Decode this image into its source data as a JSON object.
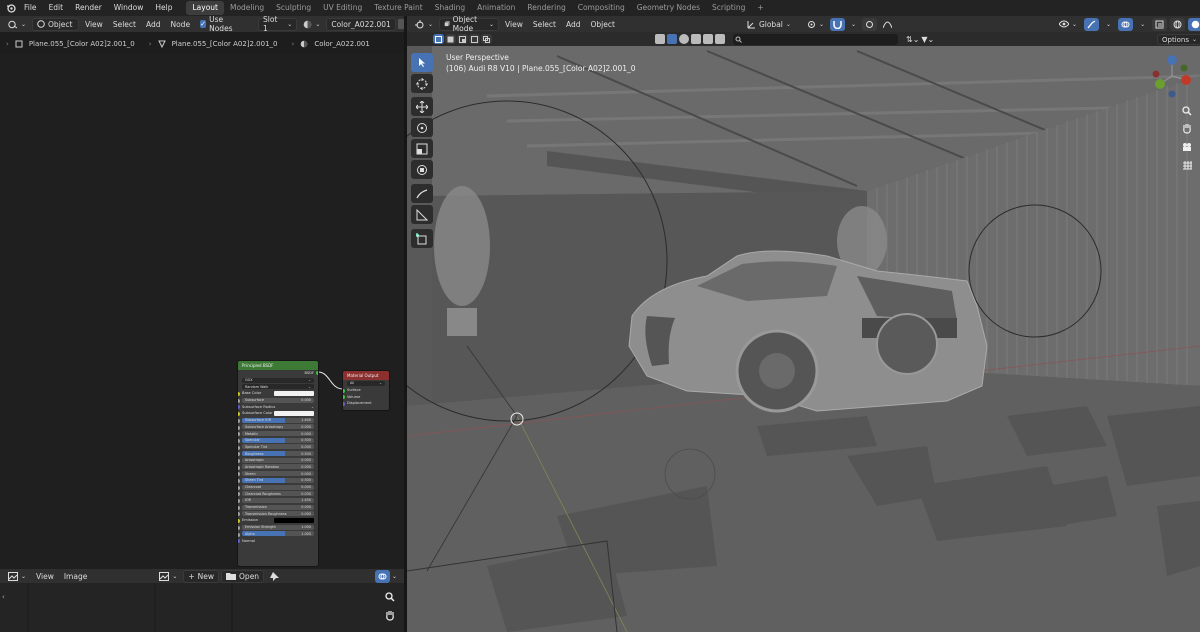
{
  "topbar": {
    "menus": [
      "File",
      "Edit",
      "Render",
      "Window",
      "Help"
    ],
    "workspaces": [
      "Layout",
      "Modeling",
      "Sculpting",
      "UV Editing",
      "Texture Paint",
      "Shading",
      "Animation",
      "Rendering",
      "Compositing",
      "Geometry Nodes",
      "Scripting"
    ],
    "active_workspace": "Layout",
    "add_label": "+"
  },
  "node_header": {
    "object_dropdown": "Object",
    "menus": [
      "View",
      "Select",
      "Add",
      "Node"
    ],
    "use_nodes_label": "Use Nodes",
    "slot": "Slot 1",
    "material": "Color_A022.001"
  },
  "breadcrumb": {
    "items": [
      "Plane.055_[Color A02]2.001_0",
      "Plane.055_[Color A02]2.001_0",
      "Color_A022.001"
    ]
  },
  "principled": {
    "title": "Principled BSDF",
    "output": "BSDF",
    "distribution": "GGX",
    "subsurface_method": "Random Walk",
    "rows": [
      {
        "label": "Base Color",
        "value": "",
        "sock": "c",
        "type": "color"
      },
      {
        "label": "Subsurface",
        "value": "0.000",
        "sock": "g",
        "type": "field"
      },
      {
        "label": "Subsurface Radius",
        "value": "",
        "sock": "v",
        "type": "drop"
      },
      {
        "label": "Subsurface Color",
        "value": "",
        "sock": "c",
        "type": "color"
      },
      {
        "label": "Subsurface IOR",
        "value": "1.400",
        "sock": "g",
        "type": "field",
        "hl": true
      },
      {
        "label": "Subsurface Anisotropy",
        "value": "0.000",
        "sock": "g",
        "type": "field"
      },
      {
        "label": "Metallic",
        "value": "0.000",
        "sock": "g",
        "type": "field"
      },
      {
        "label": "Specular",
        "value": "0.500",
        "sock": "g",
        "type": "field",
        "hl": true
      },
      {
        "label": "Specular Tint",
        "value": "0.000",
        "sock": "g",
        "type": "field"
      },
      {
        "label": "Roughness",
        "value": "0.500",
        "sock": "g",
        "type": "field",
        "hl": true
      },
      {
        "label": "Anisotropic",
        "value": "0.000",
        "sock": "g",
        "type": "field"
      },
      {
        "label": "Anisotropic Rotation",
        "value": "0.000",
        "sock": "g",
        "type": "field"
      },
      {
        "label": "Sheen",
        "value": "0.000",
        "sock": "g",
        "type": "field"
      },
      {
        "label": "Sheen Tint",
        "value": "0.500",
        "sock": "g",
        "type": "field",
        "hl": true
      },
      {
        "label": "Clearcoat",
        "value": "0.000",
        "sock": "g",
        "type": "field"
      },
      {
        "label": "Clearcoat Roughness",
        "value": "0.030",
        "sock": "g",
        "type": "field"
      },
      {
        "label": "IOR",
        "value": "1.450",
        "sock": "g",
        "type": "field"
      },
      {
        "label": "Transmission",
        "value": "0.000",
        "sock": "g",
        "type": "field"
      },
      {
        "label": "Transmission Roughness",
        "value": "0.000",
        "sock": "g",
        "type": "field"
      },
      {
        "label": "Emission",
        "value": "",
        "sock": "c",
        "type": "black"
      },
      {
        "label": "Emission Strength",
        "value": "1.000",
        "sock": "g",
        "type": "field"
      },
      {
        "label": "Alpha",
        "value": "1.000",
        "sock": "g",
        "type": "field",
        "hl": true
      },
      {
        "label": "Normal",
        "value": "",
        "sock": "v",
        "type": "plain"
      }
    ]
  },
  "material_output": {
    "title": "Material Output",
    "target": "All",
    "inputs": [
      "Surface",
      "Volume",
      "Displacement"
    ]
  },
  "viewport_header": {
    "mode": "Object Mode",
    "menus": [
      "View",
      "Select",
      "Add",
      "Object"
    ],
    "orientation": "Global",
    "options_label": "Options"
  },
  "viewport": {
    "perspective_label": "User Perspective",
    "object_label": "(106) Audi R8 V10 | Plane.055_[Color A02]2.001_0"
  },
  "image_editor": {
    "menus": [
      "View",
      "Image"
    ],
    "new_label": "New",
    "open_label": "Open"
  },
  "colors": {
    "accent": "#4772b3",
    "node_header_green": "#3c7a36",
    "node_header_red": "#8c2f2f"
  }
}
